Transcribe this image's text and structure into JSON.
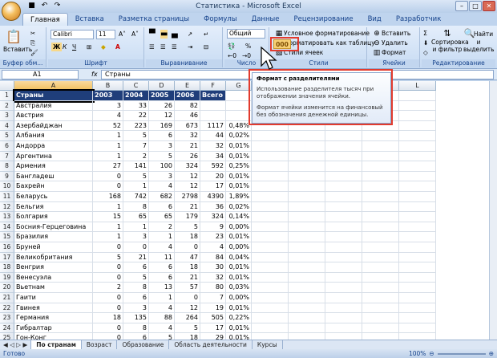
{
  "window": {
    "title": "Статистика - Microsoft Excel"
  },
  "tabs": [
    "Главная",
    "Вставка",
    "Разметка страницы",
    "Формулы",
    "Данные",
    "Рецензирование",
    "Вид",
    "Разработчик"
  ],
  "ribbon": {
    "clipboard": {
      "paste": "Вставить",
      "label": "Буфер обм..."
    },
    "font": {
      "name": "Calibri",
      "size": "11",
      "label": "Шрифт"
    },
    "alignment": {
      "label": "Выравнивание"
    },
    "number": {
      "format": "Общий",
      "percent": "%",
      "thousands": "000",
      "label": "Число"
    },
    "styles": {
      "conditional": "Условное форматирование",
      "as_table": "Форматировать как таблицу",
      "cell_styles": "Стили ячеек",
      "label": "Стили"
    },
    "cells": {
      "insert": "Вставить",
      "delete": "Удалить",
      "format": "Формат",
      "label": "Ячейки"
    },
    "editing": {
      "sort": "Сортировка и фильтр",
      "find": "Найти и выделить",
      "label": "Редактирование"
    }
  },
  "formula_bar": {
    "name_box": "A1",
    "fx": "fx",
    "value": "Страны"
  },
  "tooltip": {
    "title": "Формат с разделителями",
    "line1": "Использование разделителя тысяч при отображении значения ячейки.",
    "line2": "Формат ячейки изменится на финансовый без обозначения денежной единицы."
  },
  "columns": [
    "A",
    "B",
    "C",
    "D",
    "E",
    "F",
    "G",
    "H",
    "I",
    "J",
    "K",
    "L"
  ],
  "header_row": [
    "Страны",
    "2003",
    "2004",
    "2005",
    "2006",
    "Всего",
    ""
  ],
  "rows": [
    [
      "Австралия",
      "3",
      "33",
      "26",
      "82",
      "",
      ""
    ],
    [
      "Австрия",
      "4",
      "22",
      "12",
      "46",
      "",
      ""
    ],
    [
      "Азербайджан",
      "52",
      "223",
      "169",
      "673",
      "1117",
      "0,48%"
    ],
    [
      "Албания",
      "1",
      "5",
      "6",
      "32",
      "44",
      "0,02%"
    ],
    [
      "Андорра",
      "1",
      "7",
      "3",
      "21",
      "32",
      "0,01%"
    ],
    [
      "Аргентина",
      "1",
      "2",
      "5",
      "26",
      "34",
      "0,01%"
    ],
    [
      "Армения",
      "27",
      "141",
      "100",
      "324",
      "592",
      "0,25%"
    ],
    [
      "Бангладеш",
      "0",
      "5",
      "3",
      "12",
      "20",
      "0,01%"
    ],
    [
      "Бахрейн",
      "0",
      "1",
      "4",
      "12",
      "17",
      "0,01%"
    ],
    [
      "Беларусь",
      "168",
      "742",
      "682",
      "2798",
      "4390",
      "1,89%"
    ],
    [
      "Бельгия",
      "1",
      "8",
      "6",
      "21",
      "36",
      "0,02%"
    ],
    [
      "Болгария",
      "15",
      "65",
      "65",
      "179",
      "324",
      "0,14%"
    ],
    [
      "Босния-Герцеговина",
      "1",
      "1",
      "2",
      "5",
      "9",
      "0,00%"
    ],
    [
      "Бразилия",
      "1",
      "3",
      "1",
      "18",
      "23",
      "0,01%"
    ],
    [
      "Бруней",
      "0",
      "0",
      "4",
      "0",
      "4",
      "0,00%"
    ],
    [
      "Великобритания",
      "5",
      "21",
      "11",
      "47",
      "84",
      "0,04%"
    ],
    [
      "Венгрия",
      "0",
      "6",
      "6",
      "18",
      "30",
      "0,01%"
    ],
    [
      "Венесуэла",
      "0",
      "5",
      "6",
      "21",
      "32",
      "0,01%"
    ],
    [
      "Вьетнам",
      "2",
      "8",
      "13",
      "57",
      "80",
      "0,03%"
    ],
    [
      "Гаити",
      "0",
      "6",
      "1",
      "0",
      "7",
      "0,00%"
    ],
    [
      "Гвинея",
      "0",
      "3",
      "4",
      "12",
      "19",
      "0,01%"
    ],
    [
      "Германия",
      "18",
      "135",
      "88",
      "264",
      "505",
      "0,22%"
    ],
    [
      "Гибралтар",
      "0",
      "8",
      "4",
      "5",
      "17",
      "0,01%"
    ],
    [
      "Гон-Конг",
      "0",
      "6",
      "5",
      "18",
      "29",
      "0,01%"
    ]
  ],
  "sheet_tabs": [
    "По странам",
    "Возраст",
    "Образование",
    "Область деятельности",
    "Курсы"
  ],
  "status": {
    "ready": "Готово",
    "zoom": "100%"
  }
}
